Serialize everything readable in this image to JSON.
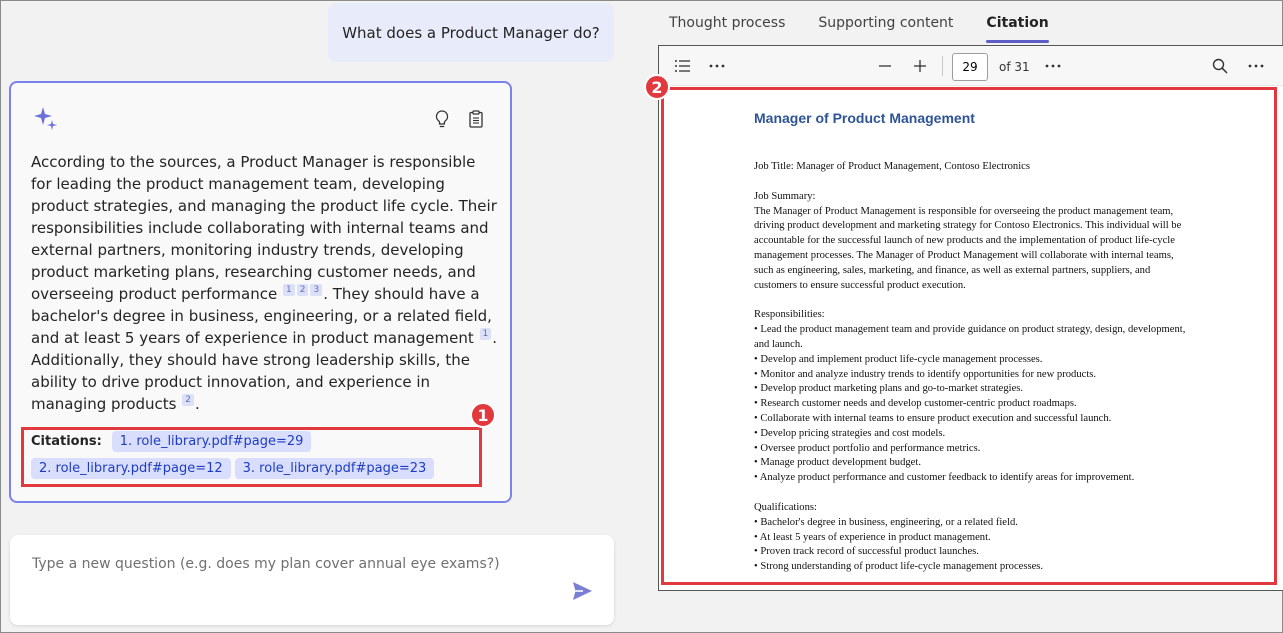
{
  "user_question": "What does a Product Manager do?",
  "answer": {
    "seg1": "According to the sources, a Product Manager is responsible for leading the product management team, developing product strategies, and managing the product life cycle. Their responsibilities include collaborating with internal teams and external partners, monitoring industry trends, developing product marketing plans, researching customer needs, and overseeing product performance",
    "seg2": ". They should have a bachelor's degree in business, engineering, or a related field, and at least 5 years of experience in product management",
    "seg3": ". Additionally, they should have strong leadership skills, the ability to drive product innovation, and experience in managing products",
    "seg4": ".",
    "refs_a": [
      "1",
      "2",
      "3"
    ],
    "refs_b": [
      "1"
    ],
    "refs_c": [
      "2"
    ]
  },
  "citations": {
    "label": "Citations:",
    "items": [
      "1. role_library.pdf#page=29",
      "2. role_library.pdf#page=12",
      "3. role_library.pdf#page=23"
    ]
  },
  "callouts": [
    "1",
    "2"
  ],
  "input": {
    "placeholder": "Type a new question (e.g. does my plan cover annual eye exams?)"
  },
  "tabs": [
    "Thought process",
    "Supporting content",
    "Citation"
  ],
  "active_tab": "Citation",
  "viewer": {
    "page": "29",
    "of_pages": "of 31"
  },
  "document": {
    "title": "Manager of Product Management",
    "job_title": "Job Title: Manager of Product Management, Contoso Electronics",
    "summary_heading": "Job Summary:",
    "summary": "The Manager of Product Management is responsible for overseeing the product management team, driving product development and marketing strategy for Contoso Electronics. This individual will be accountable for the successful launch of new products and the implementation of product life-cycle management processes. The Manager of Product Management will collaborate with internal teams, such as engineering, sales, marketing, and finance, as well as external partners, suppliers, and customers to ensure successful product execution.",
    "responsibilities_heading": "Responsibilities:",
    "responsibilities": [
      "• Lead the product management team and provide guidance on product strategy, design, development, and launch.",
      "• Develop and implement product life-cycle management processes.",
      "• Monitor and analyze industry trends to identify opportunities for new products.",
      "• Develop product marketing plans and go-to-market strategies.",
      "• Research customer needs and develop customer-centric product roadmaps.",
      "• Collaborate with internal teams to ensure product execution and successful launch.",
      "• Develop pricing strategies and cost models.",
      "• Oversee product portfolio and performance metrics.",
      "• Manage product development budget.",
      "• Analyze product performance and customer feedback to identify areas for improvement."
    ],
    "qualifications_heading": "Qualifications:",
    "qualifications": [
      "• Bachelor's degree in business, engineering, or a related field.",
      "• At least 5 years of experience in product management.",
      "• Proven track record of successful product launches.",
      "• Strong understanding of product life-cycle management processes."
    ]
  },
  "colors": {
    "accent": "#5b5fc7",
    "card_border": "#7b83eb",
    "highlight": "#e2393f",
    "chip_bg": "#d9deff",
    "doc_title": "#2f5496"
  },
  "icons": [
    "sparkle-icon",
    "lightbulb-icon",
    "clipboard-icon",
    "send-icon",
    "list-icon",
    "more-icon",
    "minus-icon",
    "plus-icon",
    "search-icon"
  ]
}
